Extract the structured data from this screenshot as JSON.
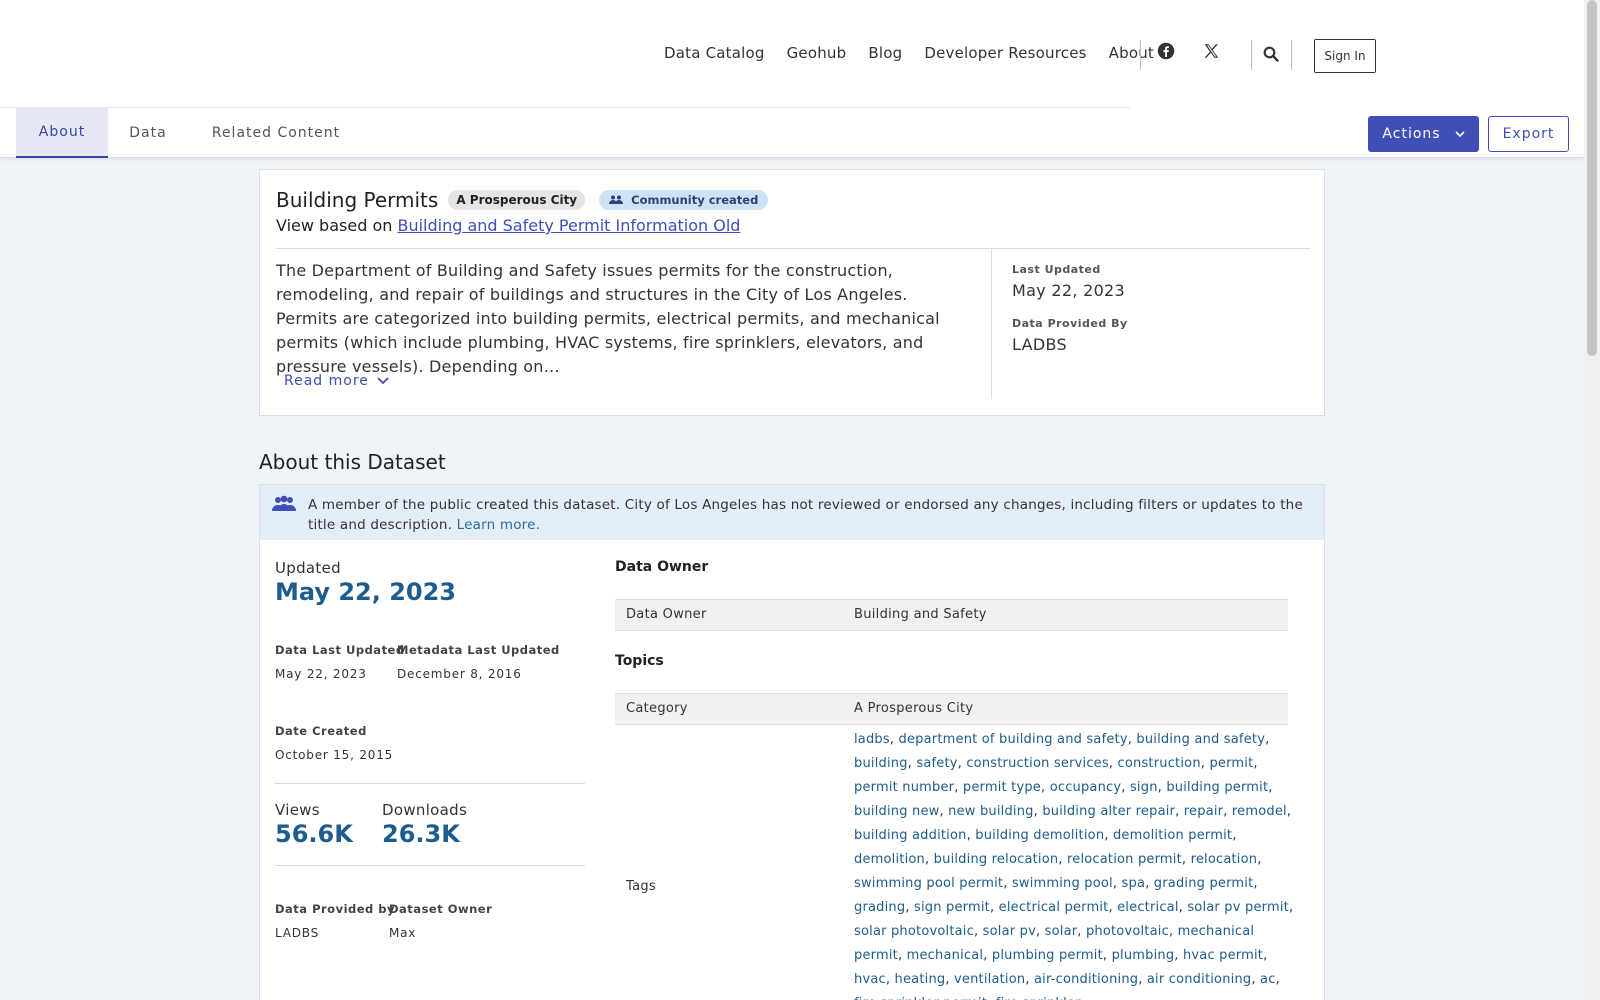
{
  "nav": {
    "items": [
      "Data Catalog",
      "Geohub",
      "Blog",
      "Developer Resources",
      "About"
    ],
    "sign_in": "Sign In"
  },
  "tabs": {
    "about": "About",
    "data": "Data",
    "related": "Related Content",
    "actions": "Actions",
    "export": "Export"
  },
  "summary": {
    "title": "Building Permits",
    "category_badge": "A Prosperous City",
    "community_badge": "Community created",
    "view_based_prefix": "View based on",
    "view_based_link": "Building and Safety Permit Information Old",
    "description": "The Department of Building and Safety issues permits for the construction, remodeling, and repair of buildings and structures in the City of Los Angeles. Permits are categorized into building permits, electrical permits, and mechanical permits (which include plumbing, HVAC systems, fire sprinklers, elevators, and pressure vessels). Depending on…",
    "read_more": "Read more",
    "last_updated_label": "Last Updated",
    "last_updated": "May 22, 2023",
    "provided_by_label": "Data Provided By",
    "provided_by": "LADBS"
  },
  "about": {
    "section_title": "About this Dataset",
    "notice": "A member of the public created this dataset. City of Los Angeles has not reviewed or endorsed any changes, including filters or updates to the title and description.",
    "notice_link": "Learn more.",
    "updated_label": "Updated",
    "updated": "May 22, 2023",
    "data_last_updated_label": "Data Last Updated",
    "data_last_updated": "May 22, 2023",
    "metadata_last_updated_label": "Metadata Last Updated",
    "metadata_last_updated": "December 8, 2016",
    "date_created_label": "Date Created",
    "date_created": "October 15, 2015",
    "views_label": "Views",
    "views": "56.6K",
    "downloads_label": "Downloads",
    "downloads": "26.3K",
    "data_provided_by_label": "Data Provided by",
    "data_provided_by": "LADBS",
    "dataset_owner_label": "Dataset Owner",
    "dataset_owner": "Max"
  },
  "details": {
    "data_owner_head": "Data Owner",
    "data_owner_key": "Data Owner",
    "data_owner_val": "Building and Safety",
    "topics_head": "Topics",
    "category_key": "Category",
    "category_val": "A Prosperous City",
    "tags_key": "Tags",
    "tags": [
      "ladbs",
      "department of building and safety",
      "building and safety",
      "building",
      "safety",
      "construction services",
      "construction",
      "permit",
      "permit number",
      "permit type",
      "occupancy",
      "sign",
      "building permit",
      "building new",
      "new building",
      "building alter repair",
      "repair",
      "remodel",
      "building addition",
      "building demolition",
      "demolition permit",
      "demolition",
      "building relocation",
      "relocation permit",
      "relocation",
      "swimming pool permit",
      "swimming pool",
      "spa",
      "grading permit",
      "grading",
      "sign permit",
      "electrical permit",
      "electrical",
      "solar pv permit",
      "solar photovoltaic",
      "solar pv",
      "solar",
      "photovoltaic",
      "mechanical permit",
      "mechanical",
      "plumbing permit",
      "plumbing",
      "hvac permit",
      "hvac",
      "heating",
      "ventilation",
      "air-conditioning",
      "air conditioning",
      "ac",
      "fire sprinkler permit",
      "fire sprinkler"
    ]
  },
  "colors": {
    "primary": "#3f4fb5",
    "accent_blue": "#1d5c8c",
    "notice_bg": "#e4eef8"
  }
}
